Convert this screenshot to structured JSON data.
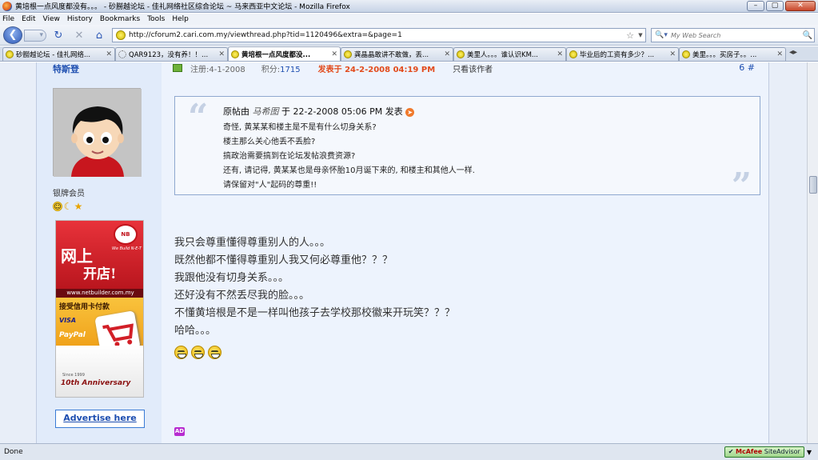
{
  "window": {
    "title": "黄培根一点风度都没有。。。 - 砂朥越论坛 - 佳礼网络社区综合论坛 ~ 马来西亚中文论坛 - Mozilla Firefox",
    "controls": [
      "–",
      "▢",
      "✕"
    ]
  },
  "menu": [
    "File",
    "Edit",
    "View",
    "History",
    "Bookmarks",
    "Tools",
    "Help"
  ],
  "nav": {
    "url": "http://cforum2.cari.com.my/viewthread.php?tid=1120496&extra=&page=1",
    "search_placeholder": "My Web Search"
  },
  "tabs": [
    {
      "label": "砂朥越论坛 - 佳礼网络...",
      "active": false
    },
    {
      "label": "QAR9123，没有养！！...",
      "active": false,
      "loading": true
    },
    {
      "label": "黄培根一点风度都没...",
      "active": true
    },
    {
      "label": "龚晶晶敢讲不敢做，丢...",
      "active": false
    },
    {
      "label": "美里人。。。谁认识KM...",
      "active": false
    },
    {
      "label": "毕业后的工资有多少？...",
      "active": false
    },
    {
      "label": "美里。。。买房子。。...",
      "active": false
    }
  ],
  "author": {
    "name": "特斯登",
    "level": "银牌会员",
    "advertise_label": "Advertise here"
  },
  "ad": {
    "brand_tag": "NB",
    "slogan": "We Build N-E-T",
    "headline1": "网上",
    "headline2": "开店!",
    "site": "www.netbuilder.com.my",
    "accept": "接受信用卡付款",
    "visa": "VISA",
    "paypal": "PayPal",
    "since": "Since 1999",
    "anniv": "10th Anniversary"
  },
  "post": {
    "registered": "注册:4-1-2008",
    "points_label": "积分:",
    "points_value": "1715",
    "posted": "发表于 24-2-2008 04:19 PM",
    "author_only": "只看该作者",
    "floor": "6 #",
    "quote": {
      "prefix": "原帖由",
      "quoted_user": "马希图",
      "suffix": "于 22-2-2008 05:06 PM 发表",
      "lines": [
        "奇怪, 黄某某和楼主是不是有什么切身关系?",
        "楼主那么关心他丢不丢脸?",
        "搞政治需要搞到在论坛发帖浪费资源?",
        "还有, 请记得, 黄某某也是母亲怀胎10月诞下来的, 和楼主和其他人一样.",
        "请保留对\"人\"起码的尊重!!"
      ]
    },
    "message_lines": [
      "我只会尊重懂得尊重别人的人。。。",
      "既然他都不懂得尊重别人我又何必尊重他？？？",
      "我跟他没有切身关系。。。",
      "还好没有不然丢尽我的脸。。。",
      "不懂黄培根是不是一样叫他孩子去学校那校徽来开玩笑？？？",
      "哈哈。。。"
    ],
    "ad_mark": "AD"
  },
  "status": {
    "text": "Done",
    "mcafee_brand": "McAfee",
    "mcafee_product": "SiteAdvisor"
  }
}
